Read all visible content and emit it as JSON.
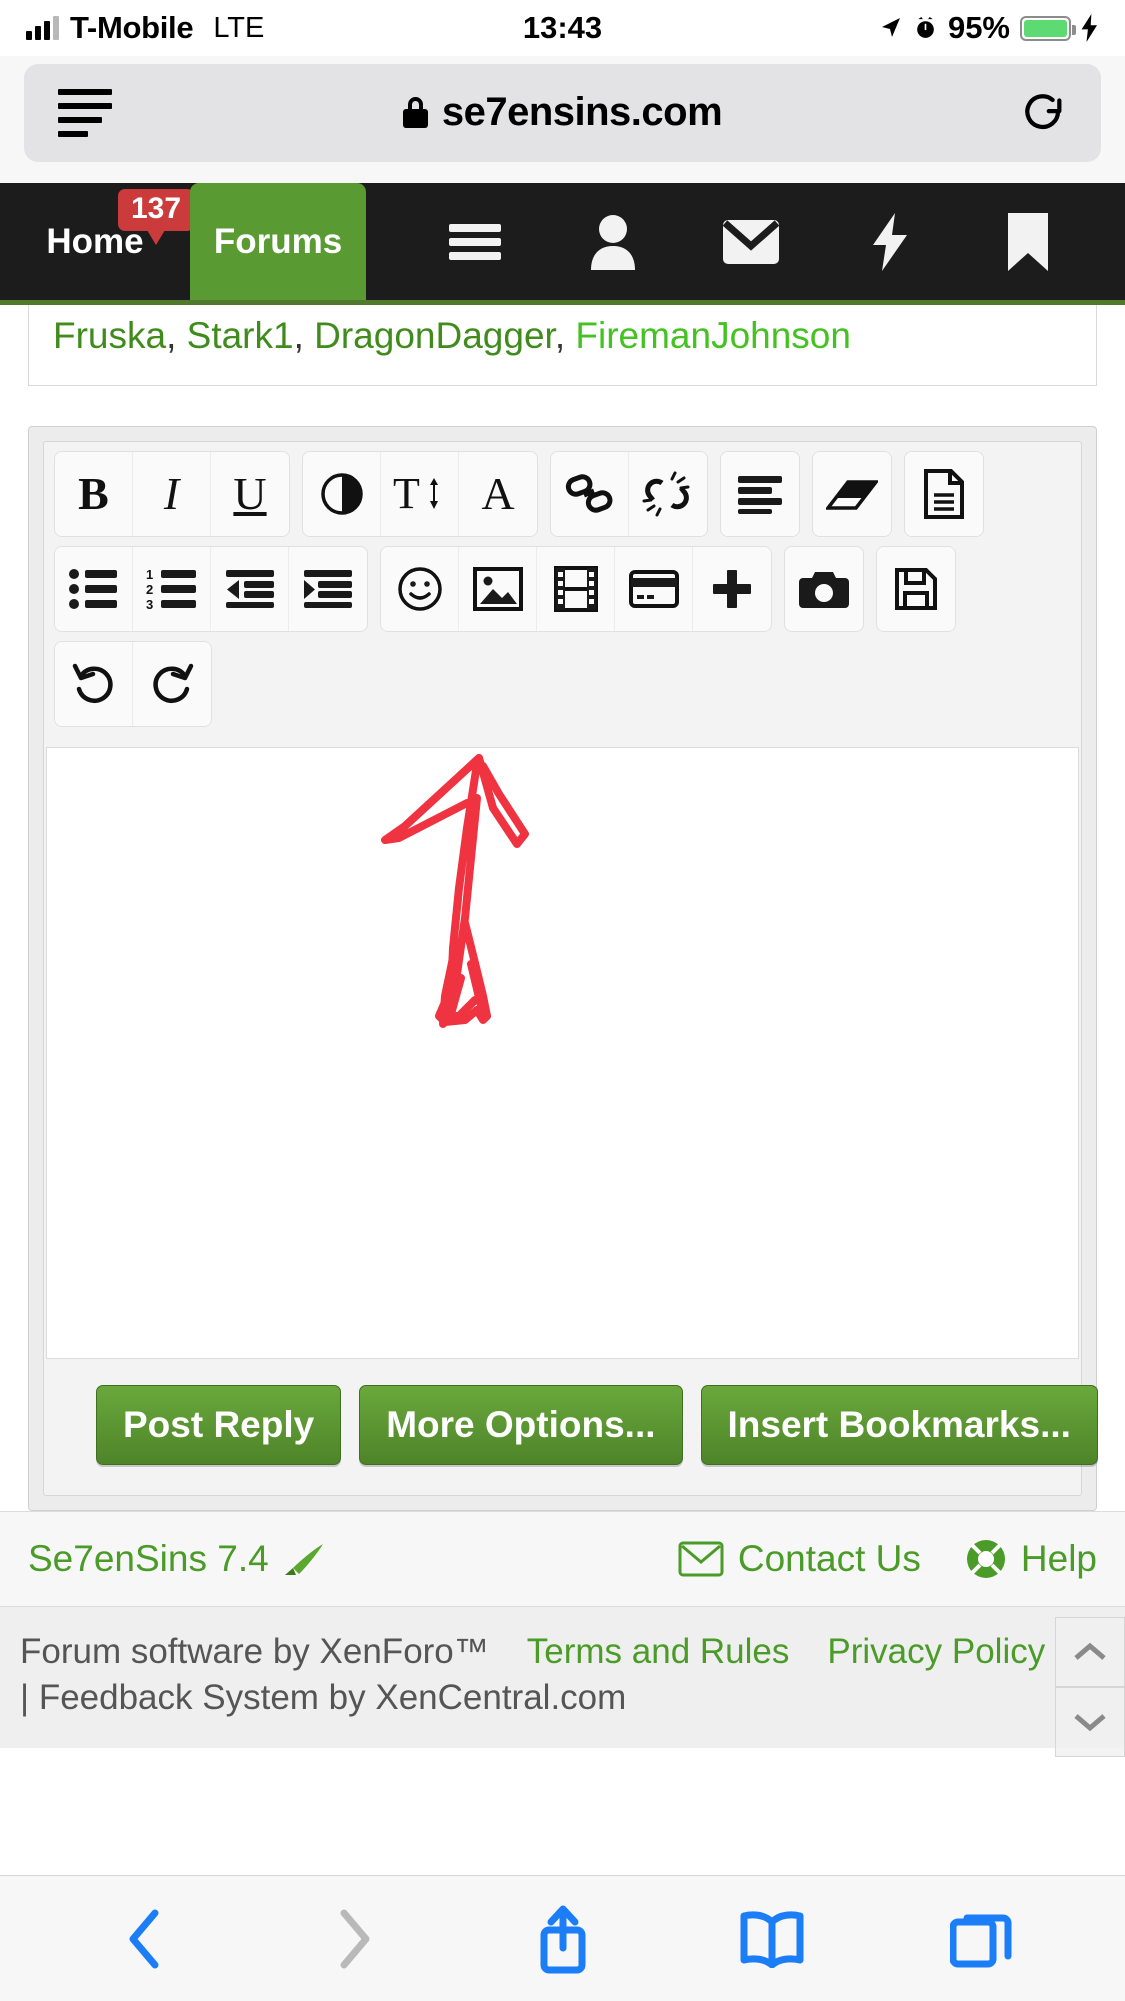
{
  "status_bar": {
    "carrier": "T-Mobile",
    "network": "LTE",
    "time": "13:43",
    "battery_percent": "95%",
    "battery_fill_color": "#5ddb72",
    "icons": [
      "signal-bars-icon",
      "location-arrow-icon",
      "alarm-clock-icon",
      "battery-icon",
      "charging-bolt-icon"
    ]
  },
  "browser": {
    "url": "se7ensins.com",
    "secure": true,
    "icons": [
      "reader-view-icon",
      "lock-icon",
      "reload-icon"
    ]
  },
  "site_nav": {
    "tabs": [
      {
        "label": "Home",
        "active": false,
        "badge": "137"
      },
      {
        "label": "Forums",
        "active": true
      }
    ],
    "active_color": "#5a9a33",
    "badge_color": "#cc3b3b",
    "icons": [
      "hamburger-menu-icon",
      "user-icon",
      "mail-icon",
      "lightning-bolt-icon",
      "bookmark-icon"
    ]
  },
  "thread": {
    "liked_by": [
      {
        "name": "Fruska",
        "bright": false
      },
      {
        "name": "Stark1",
        "bright": false
      },
      {
        "name": "DragonDagger",
        "bright": false
      },
      {
        "name": "FiremanJohnson",
        "bright": true
      }
    ],
    "separator": ", "
  },
  "editor": {
    "toolbar_rows": [
      [
        {
          "group": [
            {
              "name": "bold-button",
              "glyph": "B",
              "style": "b"
            },
            {
              "name": "italic-button",
              "glyph": "I",
              "style": "i"
            },
            {
              "name": "underline-button",
              "glyph": "U",
              "style": "u"
            }
          ]
        },
        {
          "group": [
            {
              "name": "text-color-button",
              "icon": "color-circle-icon"
            },
            {
              "name": "font-size-button",
              "icon": "font-size-icon"
            },
            {
              "name": "font-family-button",
              "icon": "font-family-icon"
            }
          ]
        },
        {
          "group": [
            {
              "name": "insert-link-button",
              "icon": "link-icon"
            },
            {
              "name": "remove-link-button",
              "icon": "unlink-icon"
            }
          ]
        },
        {
          "group": [
            {
              "name": "align-button",
              "icon": "align-left-icon"
            }
          ]
        },
        {
          "group": [
            {
              "name": "remove-formatting-button",
              "icon": "eraser-icon"
            }
          ]
        },
        {
          "group": [
            {
              "name": "draft-button",
              "icon": "document-icon"
            }
          ]
        }
      ],
      [
        {
          "group": [
            {
              "name": "bullet-list-button",
              "icon": "bullet-list-icon"
            },
            {
              "name": "numbered-list-button",
              "icon": "numbered-list-icon"
            },
            {
              "name": "outdent-button",
              "icon": "outdent-icon"
            },
            {
              "name": "indent-button",
              "icon": "indent-icon"
            }
          ]
        },
        {
          "group": [
            {
              "name": "smilies-button",
              "icon": "smiley-icon"
            },
            {
              "name": "insert-image-button",
              "icon": "image-icon"
            },
            {
              "name": "insert-media-button",
              "icon": "film-icon"
            },
            {
              "name": "insert-card-button",
              "icon": "card-icon"
            },
            {
              "name": "more-button",
              "icon": "plus-icon"
            }
          ]
        },
        {
          "group": [
            {
              "name": "camera-button",
              "icon": "camera-icon"
            }
          ]
        },
        {
          "group": [
            {
              "name": "save-button",
              "icon": "floppy-disk-icon"
            }
          ]
        }
      ],
      [
        {
          "group": [
            {
              "name": "undo-button",
              "icon": "undo-icon"
            },
            {
              "name": "redo-button",
              "icon": "redo-icon"
            }
          ]
        }
      ]
    ],
    "canvas": {
      "content_description": "red hand-drawn up arrow",
      "stroke_color": "#ef3340",
      "value": "",
      "placeholder": ""
    },
    "buttons": [
      {
        "name": "post-reply-button",
        "label": "Post Reply"
      },
      {
        "name": "more-options-button",
        "label": "More Options..."
      },
      {
        "name": "insert-bookmarks-button",
        "label": "Insert Bookmarks..."
      }
    ],
    "scroll_controls": [
      "scroll-up-button",
      "scroll-down-button"
    ]
  },
  "footer": {
    "version": "Se7enSins 7.4",
    "version_icon": "paintbrush-icon",
    "links": [
      {
        "name": "contact-us-link",
        "label": "Contact Us",
        "icon": "envelope-icon"
      },
      {
        "name": "help-link",
        "label": "Help",
        "icon": "lifebuoy-icon"
      }
    ],
    "credit_prefix": "Forum software by XenForo™",
    "terms_label": "Terms and Rules",
    "privacy_label": "Privacy Policy",
    "credit_suffix": "| Feedback System by XenCentral.com"
  },
  "safari_toolbar": {
    "buttons": [
      {
        "name": "back-button",
        "icon": "chevron-left-icon",
        "enabled": true
      },
      {
        "name": "forward-button",
        "icon": "chevron-right-icon",
        "enabled": false
      },
      {
        "name": "share-button",
        "icon": "share-icon",
        "enabled": true
      },
      {
        "name": "bookmarks-button",
        "icon": "book-icon",
        "enabled": true
      },
      {
        "name": "tabs-button",
        "icon": "tabs-icon",
        "enabled": true
      }
    ]
  }
}
